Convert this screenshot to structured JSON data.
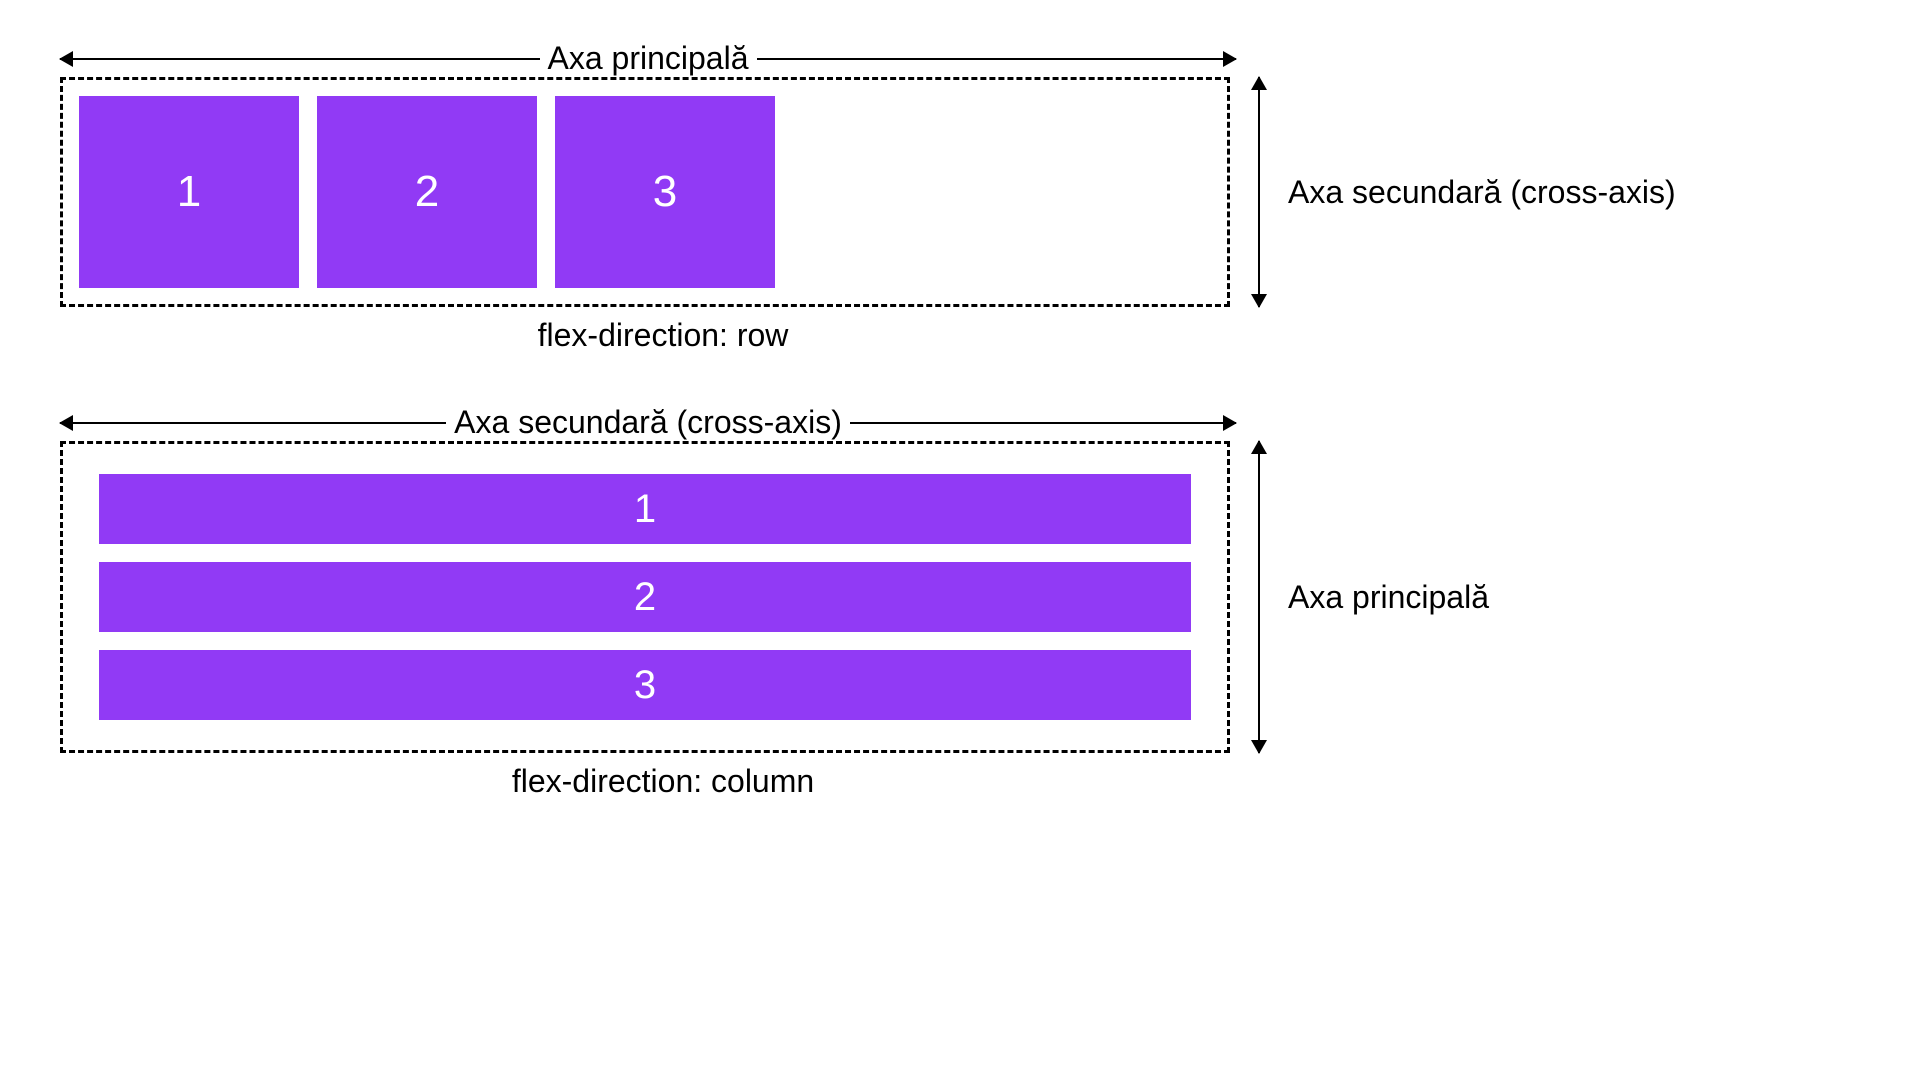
{
  "diagrams": {
    "row": {
      "main_axis_label": "Axa principală",
      "cross_axis_label": "Axa secundară (cross-axis)",
      "caption": "flex-direction: row",
      "items": [
        "1",
        "2",
        "3"
      ]
    },
    "column": {
      "top_axis_label": "Axa secundară (cross-axis)",
      "side_axis_label": "Axa principală",
      "caption": "flex-direction: column",
      "items": [
        "1",
        "2",
        "3"
      ]
    }
  },
  "colors": {
    "item_bg": "#913af5",
    "item_fg": "#ffffff"
  }
}
